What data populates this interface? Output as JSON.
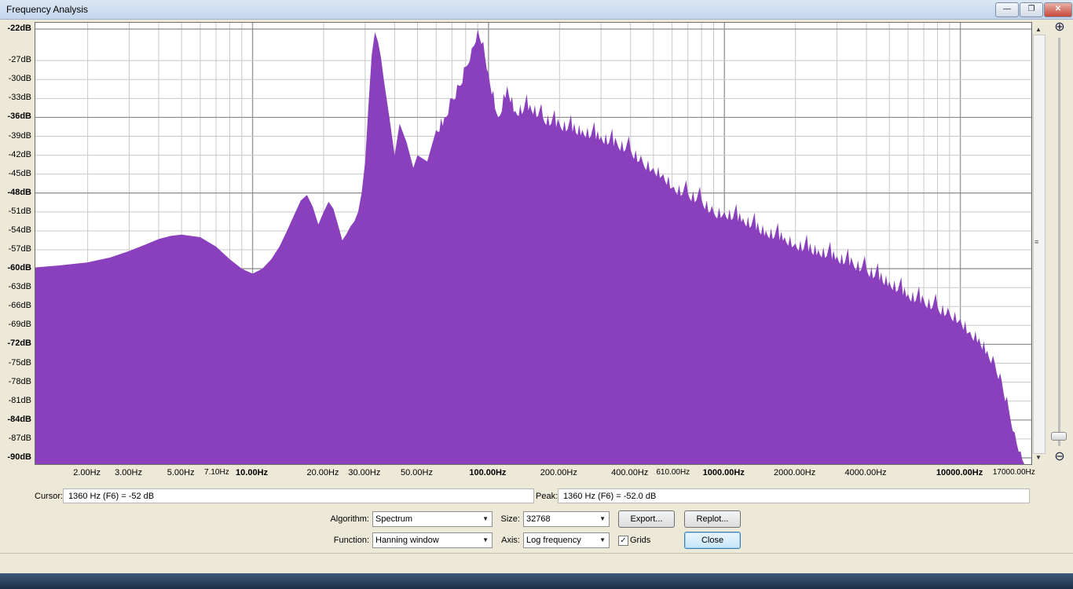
{
  "window": {
    "title": "Frequency Analysis",
    "minimize_label": "—",
    "restore_label": "❐",
    "close_label": "✕"
  },
  "chart_data": {
    "type": "area",
    "title": "",
    "xlabel": "",
    "ylabel": "",
    "xscale": "log",
    "xlim": [
      1.2,
      20000
    ],
    "ylim": [
      -91,
      -21
    ],
    "grid": true,
    "fill_color": "#8a3fbd",
    "y_ticks": [
      {
        "label": "-22dB",
        "value": -22,
        "major": true
      },
      {
        "label": "-27dB",
        "value": -27,
        "major": false
      },
      {
        "label": "-30dB",
        "value": -30,
        "major": false
      },
      {
        "label": "-33dB",
        "value": -33,
        "major": false
      },
      {
        "label": "-36dB",
        "value": -36,
        "major": true
      },
      {
        "label": "-39dB",
        "value": -39,
        "major": false
      },
      {
        "label": "-42dB",
        "value": -42,
        "major": false
      },
      {
        "label": "-45dB",
        "value": -45,
        "major": false
      },
      {
        "label": "-48dB",
        "value": -48,
        "major": true
      },
      {
        "label": "-51dB",
        "value": -51,
        "major": false
      },
      {
        "label": "-54dB",
        "value": -54,
        "major": false
      },
      {
        "label": "-57dB",
        "value": -57,
        "major": false
      },
      {
        "label": "-60dB",
        "value": -60,
        "major": true
      },
      {
        "label": "-63dB",
        "value": -63,
        "major": false
      },
      {
        "label": "-66dB",
        "value": -66,
        "major": false
      },
      {
        "label": "-69dB",
        "value": -69,
        "major": false
      },
      {
        "label": "-72dB",
        "value": -72,
        "major": true
      },
      {
        "label": "-75dB",
        "value": -75,
        "major": false
      },
      {
        "label": "-78dB",
        "value": -78,
        "major": false
      },
      {
        "label": "-81dB",
        "value": -81,
        "major": false
      },
      {
        "label": "-84dB",
        "value": -84,
        "major": true
      },
      {
        "label": "-87dB",
        "value": -87,
        "major": false
      },
      {
        "label": "-90dB",
        "value": -90,
        "major": true
      }
    ],
    "x_ticks": [
      {
        "label": "2.00Hz",
        "value": 2,
        "major": false,
        "small": false
      },
      {
        "label": "3.00Hz",
        "value": 3,
        "major": false,
        "small": false
      },
      {
        "label": "5.00Hz",
        "value": 5,
        "major": false,
        "small": false
      },
      {
        "label": "7.10Hz",
        "value": 7.1,
        "major": false,
        "small": true
      },
      {
        "label": "10.00Hz",
        "value": 10,
        "major": true,
        "small": false
      },
      {
        "label": "20.00Hz",
        "value": 20,
        "major": false,
        "small": false
      },
      {
        "label": "30.00Hz",
        "value": 30,
        "major": false,
        "small": false
      },
      {
        "label": "50.00Hz",
        "value": 50,
        "major": false,
        "small": false
      },
      {
        "label": "100.00Hz",
        "value": 100,
        "major": true,
        "small": false
      },
      {
        "label": "200.00Hz",
        "value": 200,
        "major": false,
        "small": false
      },
      {
        "label": "400.00Hz",
        "value": 400,
        "major": false,
        "small": false
      },
      {
        "label": "610.00Hz",
        "value": 610,
        "major": false,
        "small": true
      },
      {
        "label": "1000.00Hz",
        "value": 1000,
        "major": true,
        "small": false
      },
      {
        "label": "2000.00Hz",
        "value": 2000,
        "major": false,
        "small": false
      },
      {
        "label": "4000.00Hz",
        "value": 4000,
        "major": false,
        "small": false
      },
      {
        "label": "10000.00Hz",
        "value": 10000,
        "major": true,
        "small": false
      },
      {
        "label": "17000.00Hz",
        "value": 17000,
        "major": false,
        "small": true
      }
    ],
    "series": [
      {
        "x": [
          1.2,
          1.5,
          2,
          2.5,
          3,
          3.5,
          4,
          4.5,
          5,
          6,
          7,
          8,
          9,
          10,
          11,
          12,
          13,
          14,
          15,
          16,
          17,
          18,
          19,
          20,
          21,
          22,
          23,
          24,
          25,
          26,
          27,
          28,
          29,
          30,
          31,
          32,
          33,
          34,
          35,
          36,
          38,
          40,
          42,
          45,
          48,
          50,
          55,
          60,
          65,
          70,
          75,
          80,
          85,
          90,
          95,
          100,
          110,
          120,
          130,
          150,
          170,
          200,
          250,
          300,
          350,
          400,
          450,
          500,
          550,
          610,
          700,
          800,
          900,
          1000,
          1200,
          1500,
          1800,
          2000,
          2500,
          3000,
          3500,
          4000,
          5000,
          6000,
          7000,
          8000,
          9000,
          10000,
          11000,
          12000,
          13000,
          14000,
          15000,
          16000,
          17000,
          18000,
          19000
        ],
        "y": [
          -59.8,
          -59.5,
          -59,
          -58.2,
          -57.2,
          -56.2,
          -55.3,
          -54.8,
          -54.6,
          -55,
          -56.5,
          -58.5,
          -60,
          -60.8,
          -60,
          -58.5,
          -56.5,
          -54,
          -51.5,
          -49.2,
          -48.3,
          -50.2,
          -53,
          -51,
          -49.4,
          -50.5,
          -53,
          -55.5,
          -54.5,
          -53.3,
          -52.5,
          -51,
          -48,
          -43,
          -34,
          -26,
          -22.5,
          -24,
          -26.5,
          -30,
          -36,
          -42,
          -37,
          -40,
          -44,
          -42,
          -43,
          -38,
          -36,
          -33,
          -31,
          -28,
          -25,
          -22,
          -24,
          -29,
          -36,
          -31,
          -35,
          -34,
          -36,
          -37,
          -38,
          -39,
          -40,
          -41,
          -43,
          -44,
          -45,
          -47,
          -48,
          -49,
          -51,
          -51,
          -52,
          -54,
          -55,
          -56,
          -57,
          -58,
          -59,
          -60,
          -62,
          -64,
          -65,
          -66,
          -67,
          -68,
          -70,
          -71,
          -73,
          -75,
          -78,
          -82,
          -86,
          -89,
          -91
        ]
      }
    ]
  },
  "readout": {
    "cursor_label": "Cursor:",
    "cursor_value": "1360 Hz (F6) = -52 dB",
    "peak_label": "Peak:",
    "peak_value": "1360 Hz (F6) = -52.0 dB"
  },
  "controls": {
    "algorithm_label": "Algorithm:",
    "algorithm_value": "Spectrum",
    "size_label": "Size:",
    "size_value": "32768",
    "export_label": "Export...",
    "replot_label": "Replot...",
    "function_label": "Function:",
    "function_value": "Hanning window",
    "axis_label": "Axis:",
    "axis_value": "Log frequency",
    "grids_label": "Grids",
    "grids_checked": true,
    "close_label": "Close"
  },
  "icons": {
    "zoom_in": "zoom-in-icon",
    "zoom_out": "zoom-out-icon"
  }
}
